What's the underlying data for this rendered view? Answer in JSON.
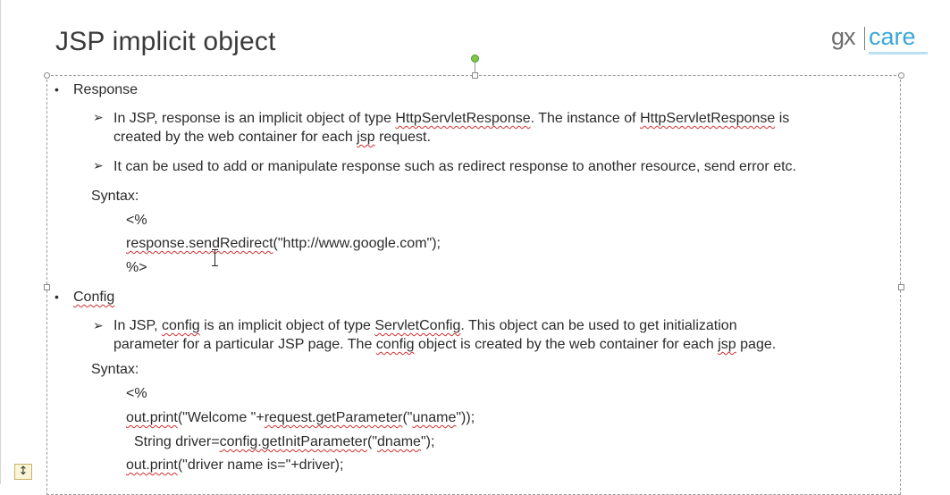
{
  "slide": {
    "title": "JSP implicit object",
    "logo": {
      "left": "gx",
      "right": "care"
    }
  },
  "sections": {
    "response": {
      "heading": "Response",
      "point1_line1_a": "In JSP, response is an implicit object of type ",
      "point1_line1_b": "HttpServletResponse",
      "point1_line1_c": ". The instance of ",
      "point1_line1_d": "HttpServletResponse",
      "point1_line1_e": " is",
      "point1_line2_a": "created by the web container for each ",
      "point1_line2_b": "jsp",
      "point1_line2_c": " request.",
      "point2": "It can be used to add or manipulate response such as redirect response to another resource, send error etc.",
      "syntax_label": "Syntax:",
      "code_open": "<%",
      "code_line_a": "response.sendRedirect",
      "code_line_b": "(\"http://www.google.com\");",
      "code_close": "%>"
    },
    "config": {
      "heading": "Config",
      "point1_line1_a": "In JSP, ",
      "point1_line1_b": "config",
      "point1_line1_c": " is an implicit object of type ",
      "point1_line1_d": "ServletConfig",
      "point1_line1_e": ". This object can be used to get initialization",
      "point1_line2_a": "parameter for a particular JSP page. The ",
      "point1_line2_b": "config",
      "point1_line2_c": " object is created by the web container for each ",
      "point1_line2_d": "jsp",
      "point1_line2_e": " page.",
      "syntax_label": "Syntax:",
      "code_open": "<%",
      "code1_a": "out.print",
      "code1_b": "(\"Welcome \"+",
      "code1_c": "request.getParameter",
      "code1_d": "(\"",
      "code1_e": "uname",
      "code1_f": "\"));",
      "code2_a": "String driver=",
      "code2_b": "config.getInitParameter",
      "code2_c": "(\"",
      "code2_d": "dname",
      "code2_e": "\");",
      "code3_a": "out.print",
      "code3_b": "(\"driver name is=\"+driver);"
    }
  },
  "ui": {
    "autofit_symbol": "↕",
    "accent_color": "#3ba7d6",
    "rotate_handle_color": "#7dc84a",
    "spell_underline_color": "#d03030"
  }
}
